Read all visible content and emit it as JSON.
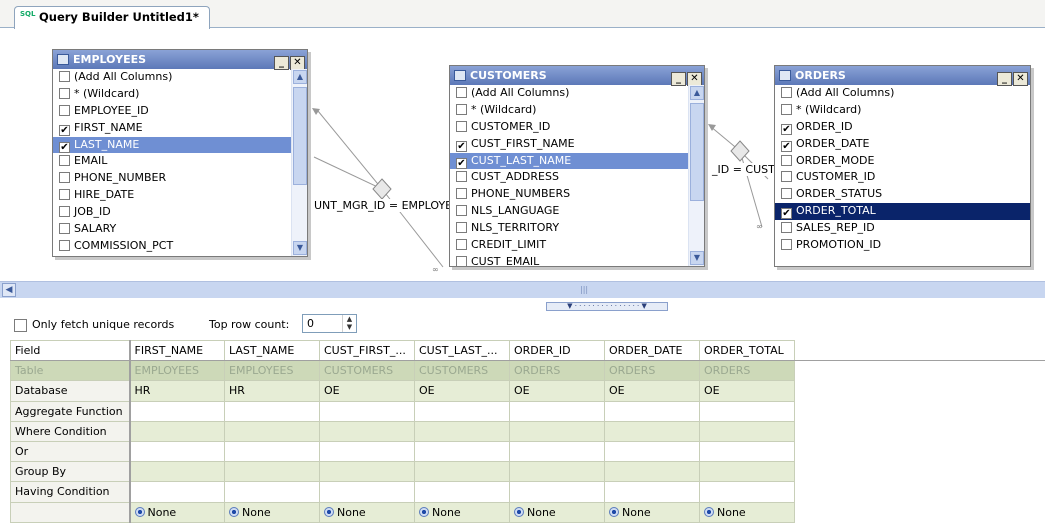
{
  "tab": {
    "title": "Query Builder Untitled1*",
    "icon_text": "SQL"
  },
  "tables": {
    "employees": {
      "name": "EMPLOYEES",
      "rows": [
        {
          "label": "(Add All Columns)",
          "checked": false
        },
        {
          "label": "* (Wildcard)",
          "checked": false
        },
        {
          "label": "EMPLOYEE_ID",
          "checked": false
        },
        {
          "label": "FIRST_NAME",
          "checked": true
        },
        {
          "label": "LAST_NAME",
          "checked": true
        },
        {
          "label": "EMAIL",
          "checked": false
        },
        {
          "label": "PHONE_NUMBER",
          "checked": false
        },
        {
          "label": "HIRE_DATE",
          "checked": false
        },
        {
          "label": "JOB_ID",
          "checked": false
        },
        {
          "label": "SALARY",
          "checked": false
        },
        {
          "label": "COMMISSION_PCT",
          "checked": false
        }
      ],
      "selected_row": "LAST_NAME"
    },
    "customers": {
      "name": "CUSTOMERS",
      "rows": [
        {
          "label": "(Add All Columns)",
          "checked": false
        },
        {
          "label": "* (Wildcard)",
          "checked": false
        },
        {
          "label": "CUSTOMER_ID",
          "checked": false
        },
        {
          "label": "CUST_FIRST_NAME",
          "checked": true
        },
        {
          "label": "CUST_LAST_NAME",
          "checked": true
        },
        {
          "label": "CUST_ADDRESS",
          "checked": false
        },
        {
          "label": "PHONE_NUMBERS",
          "checked": false
        },
        {
          "label": "NLS_LANGUAGE",
          "checked": false
        },
        {
          "label": "NLS_TERRITORY",
          "checked": false
        },
        {
          "label": "CREDIT_LIMIT",
          "checked": false
        },
        {
          "label": "CUST_EMAIL",
          "checked": false
        }
      ],
      "selected_row": "CUST_LAST_NAME"
    },
    "orders": {
      "name": "ORDERS",
      "rows": [
        {
          "label": "(Add All Columns)",
          "checked": false
        },
        {
          "label": "* (Wildcard)",
          "checked": false
        },
        {
          "label": "ORDER_ID",
          "checked": true
        },
        {
          "label": "ORDER_DATE",
          "checked": true
        },
        {
          "label": "ORDER_MODE",
          "checked": false
        },
        {
          "label": "CUSTOMER_ID",
          "checked": false
        },
        {
          "label": "ORDER_STATUS",
          "checked": false
        },
        {
          "label": "ORDER_TOTAL",
          "checked": true
        },
        {
          "label": "SALES_REP_ID",
          "checked": false
        },
        {
          "label": "PROMOTION_ID",
          "checked": false
        }
      ],
      "selected_row": "ORDER_TOTAL"
    }
  },
  "joins": {
    "left_label": "UNT_MGR_ID = EMPLOYEE",
    "right_label": "_ID = CUST"
  },
  "options": {
    "unique_label": "Only fetch unique records",
    "unique_checked": false,
    "top_row_label": "Top row count:",
    "top_row_value": "0"
  },
  "grid": {
    "columns": [
      "Field",
      "FIRST_NAME",
      "LAST_NAME",
      "CUST_FIRST_...",
      "CUST_LAST_...",
      "ORDER_ID",
      "ORDER_DATE",
      "ORDER_TOTAL"
    ],
    "rows": [
      {
        "label": "Table",
        "values": [
          "EMPLOYEES",
          "EMPLOYEES",
          "CUSTOMERS",
          "CUSTOMERS",
          "ORDERS",
          "ORDERS",
          "ORDERS"
        ]
      },
      {
        "label": "Database",
        "values": [
          "HR",
          "HR",
          "OE",
          "OE",
          "OE",
          "OE",
          "OE"
        ]
      },
      {
        "label": "Aggregate Function",
        "values": [
          "",
          "",
          "",
          "",
          "",
          "",
          ""
        ]
      },
      {
        "label": "Where Condition",
        "values": [
          "",
          "",
          "",
          "",
          "",
          "",
          ""
        ]
      },
      {
        "label": "Or",
        "values": [
          "",
          "",
          "",
          "",
          "",
          "",
          ""
        ]
      },
      {
        "label": "Group By",
        "values": [
          "",
          "",
          "",
          "",
          "",
          "",
          ""
        ]
      },
      {
        "label": "Having Condition",
        "values": [
          "",
          "",
          "",
          "",
          "",
          "",
          ""
        ]
      },
      {
        "label": "",
        "values": [
          "None",
          "None",
          "None",
          "None",
          "None",
          "None",
          "None"
        ]
      }
    ]
  }
}
